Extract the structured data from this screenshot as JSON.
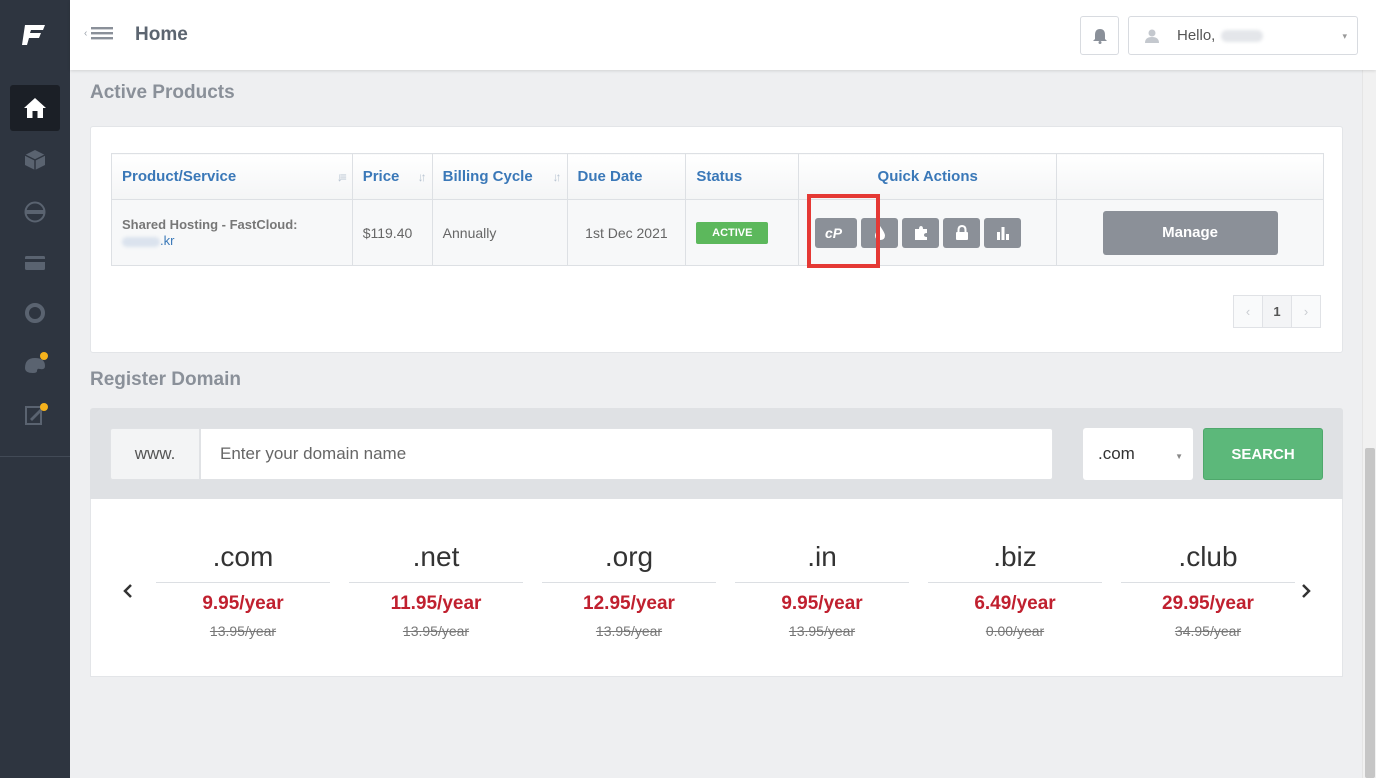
{
  "header": {
    "page_title": "Home",
    "greeting": "Hello,"
  },
  "sidebar": {
    "items": [
      {
        "name": "home",
        "icon": "home-icon"
      },
      {
        "name": "services",
        "icon": "box-icon"
      },
      {
        "name": "domains",
        "icon": "globe-icon"
      },
      {
        "name": "billing",
        "icon": "credit-card-icon"
      },
      {
        "name": "support",
        "icon": "lifebuoy-icon"
      },
      {
        "name": "marketplace",
        "icon": "palette-icon"
      },
      {
        "name": "notes",
        "icon": "edit-icon"
      }
    ]
  },
  "active_products": {
    "title": "Active Products",
    "columns": [
      "Product/Service",
      "Price",
      "Billing Cycle",
      "Due Date",
      "Status",
      "Quick Actions",
      ""
    ],
    "rows": [
      {
        "product": "Shared Hosting - FastCloud:",
        "domain_suffix": ".kr",
        "price": "$119.40",
        "billing_cycle": "Annually",
        "due_date": "1st Dec 2021",
        "status": "ACTIVE",
        "manage_label": "Manage"
      }
    ],
    "pagination": {
      "current_page": "1",
      "prev": "‹",
      "next": "›"
    }
  },
  "register_domain": {
    "title": "Register Domain",
    "prefix": "www.",
    "placeholder": "Enter your domain name",
    "tld_selected": ".com",
    "search_label": "SEARCH"
  },
  "tld_pricing": [
    {
      "tld": ".com",
      "price": "9.95/year",
      "old_price": "13.95/year"
    },
    {
      "tld": ".net",
      "price": "11.95/year",
      "old_price": "13.95/year"
    },
    {
      "tld": ".org",
      "price": "12.95/year",
      "old_price": "13.95/year"
    },
    {
      "tld": ".in",
      "price": "9.95/year",
      "old_price": "13.95/year"
    },
    {
      "tld": ".biz",
      "price": "6.49/year",
      "old_price": "0.00/year"
    },
    {
      "tld": ".club",
      "price": "29.95/year",
      "old_price": "34.95/year"
    }
  ],
  "colors": {
    "sidebar": "#2e3540",
    "accent_blue": "#3a78b8",
    "active_green": "#5cb85c",
    "search_green": "#5cb87a",
    "price_red": "#c0202f",
    "highlight_red": "#e53935"
  }
}
